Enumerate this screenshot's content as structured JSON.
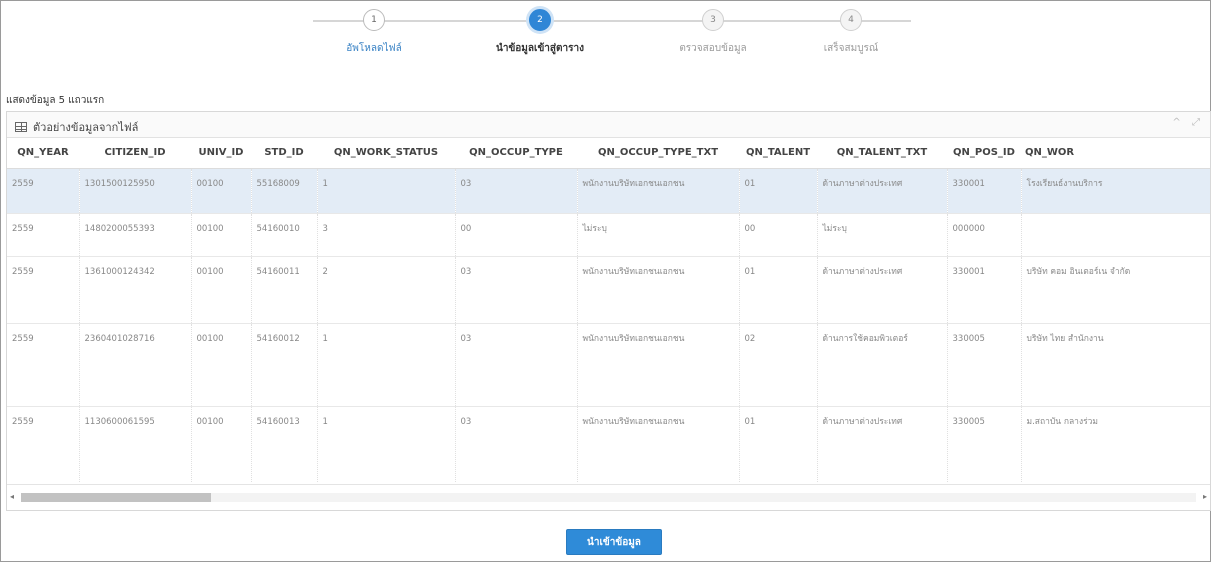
{
  "stepper": {
    "steps": [
      {
        "number": "1",
        "label": "อัพโหลดไฟล์",
        "state": "done"
      },
      {
        "number": "2",
        "label": "นำข้อมูลเข้าสู่ตาราง",
        "state": "active"
      },
      {
        "number": "3",
        "label": "ตรวจสอบข้อมูล",
        "state": "pending"
      },
      {
        "number": "4",
        "label": "เสร็จสมบูรณ์",
        "state": "pending"
      }
    ]
  },
  "summary": "แสดงข้อมูล 5 แถวแรก",
  "panel": {
    "title": "ตัวอย่างข้อมูลจากไฟล์",
    "tools": [
      "^",
      "⤢"
    ]
  },
  "table": {
    "columns": [
      "QN_YEAR",
      "CITIZEN_ID",
      "UNIV_ID",
      "STD_ID",
      "QN_WORK_STATUS",
      "QN_OCCUP_TYPE",
      "QN_OCCUP_TYPE_TXT",
      "QN_TALENT",
      "QN_TALENT_TXT",
      "QN_POS_ID",
      "QN_WOR"
    ],
    "rows": [
      [
        "2559",
        "1301500125950",
        "00100",
        "55168009",
        "1",
        "03",
        "พนักงานบริษัทเอกชนเอกชน",
        "01",
        "ด้านภาษาต่างประเทศ",
        "330001",
        "โรงเรียนธ์งานบริการ"
      ],
      [
        "2559",
        "1480200055393",
        "00100",
        "54160010",
        "3",
        "00",
        "ไม่ระบุ",
        "00",
        "ไม่ระบุ",
        "000000",
        ""
      ],
      [
        "2559",
        "1361000124342",
        "00100",
        "54160011",
        "2",
        "03",
        "พนักงานบริษัทเอกชนเอกชน",
        "01",
        "ด้านภาษาต่างประเทศ",
        "330001",
        "บริษัท คอม อินเตอร์เน จำกัด"
      ],
      [
        "2559",
        "2360401028716",
        "00100",
        "54160012",
        "1",
        "03",
        "พนักงานบริษัทเอกชนเอกชน",
        "02",
        "ด้านการใช้คอมพิวเตอร์",
        "330005",
        "บริษัท ไทย สำนักงาน"
      ],
      [
        "2559",
        "1130600061595",
        "00100",
        "54160013",
        "1",
        "03",
        "พนักงานบริษัทเอกชนเอกชน",
        "01",
        "ด้านภาษาต่างประเทศ",
        "330005",
        "ม.สถาบัน กลางร่วม"
      ]
    ],
    "selected_row": 0
  },
  "scroll": {
    "left_arrow": "◂",
    "right_arrow": "▸"
  },
  "button": {
    "label": "นำเข้าข้อมูล"
  }
}
